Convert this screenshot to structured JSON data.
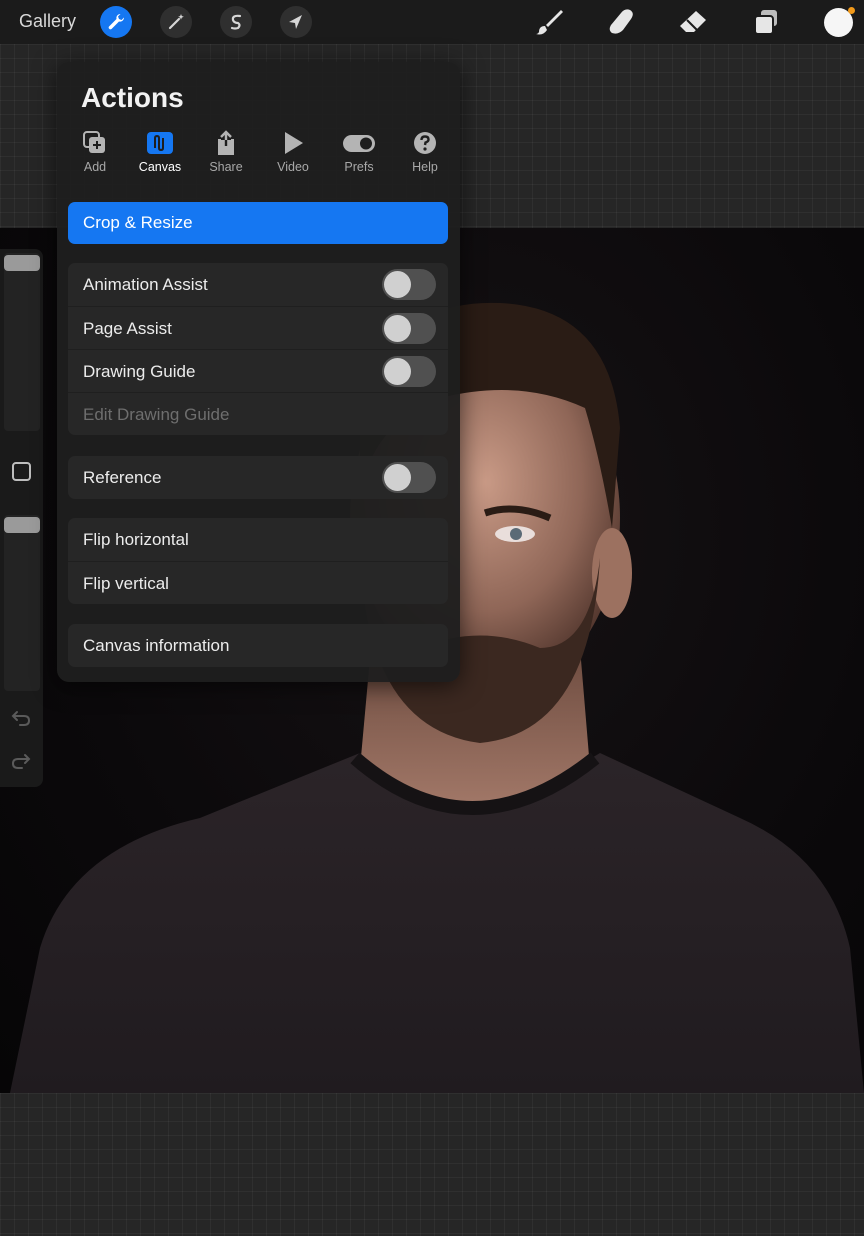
{
  "toolbar": {
    "gallery_label": "Gallery",
    "left_tools": [
      {
        "name": "actions",
        "icon": "wrench-icon",
        "active": true
      },
      {
        "name": "adjustments",
        "icon": "magic-wand-icon",
        "active": false
      },
      {
        "name": "selection",
        "icon": "selection-s-icon",
        "active": false
      },
      {
        "name": "transform",
        "icon": "arrow-cursor-icon",
        "active": false
      }
    ],
    "right_tools": [
      {
        "name": "brush",
        "icon": "brush-icon"
      },
      {
        "name": "smudge",
        "icon": "smudge-finger-icon"
      },
      {
        "name": "eraser",
        "icon": "eraser-icon"
      },
      {
        "name": "layers",
        "icon": "layers-icon"
      }
    ],
    "current_color": "#f6f6f6",
    "accent_color": "#1577f2",
    "notification_color": "#f29a1a"
  },
  "sidebar": {
    "brush_size_level": 1.0,
    "opacity_level": 1.0,
    "undo_icon": "undo-icon",
    "redo_icon": "redo-icon"
  },
  "actions_panel": {
    "title": "Actions",
    "tabs": [
      {
        "label": "Add",
        "icon": "add-file-icon",
        "active": false
      },
      {
        "label": "Canvas",
        "icon": "canvas-wave-icon",
        "active": true
      },
      {
        "label": "Share",
        "icon": "share-icon",
        "active": false
      },
      {
        "label": "Video",
        "icon": "play-icon",
        "active": false
      },
      {
        "label": "Prefs",
        "icon": "toggle-icon",
        "active": false
      },
      {
        "label": "Help",
        "icon": "question-icon",
        "active": false
      }
    ],
    "crop_resize_label": "Crop & Resize",
    "groups": [
      [
        {
          "label": "Animation Assist",
          "toggle": true,
          "on": false
        },
        {
          "label": "Page Assist",
          "toggle": true,
          "on": false
        },
        {
          "label": "Drawing Guide",
          "toggle": true,
          "on": false
        },
        {
          "label": "Edit Drawing Guide",
          "toggle": false,
          "disabled": true
        }
      ],
      [
        {
          "label": "Reference",
          "toggle": true,
          "on": false
        }
      ],
      [
        {
          "label": "Flip horizontal",
          "toggle": false
        },
        {
          "label": "Flip vertical",
          "toggle": false
        }
      ],
      [
        {
          "label": "Canvas information",
          "toggle": false
        }
      ]
    ]
  }
}
